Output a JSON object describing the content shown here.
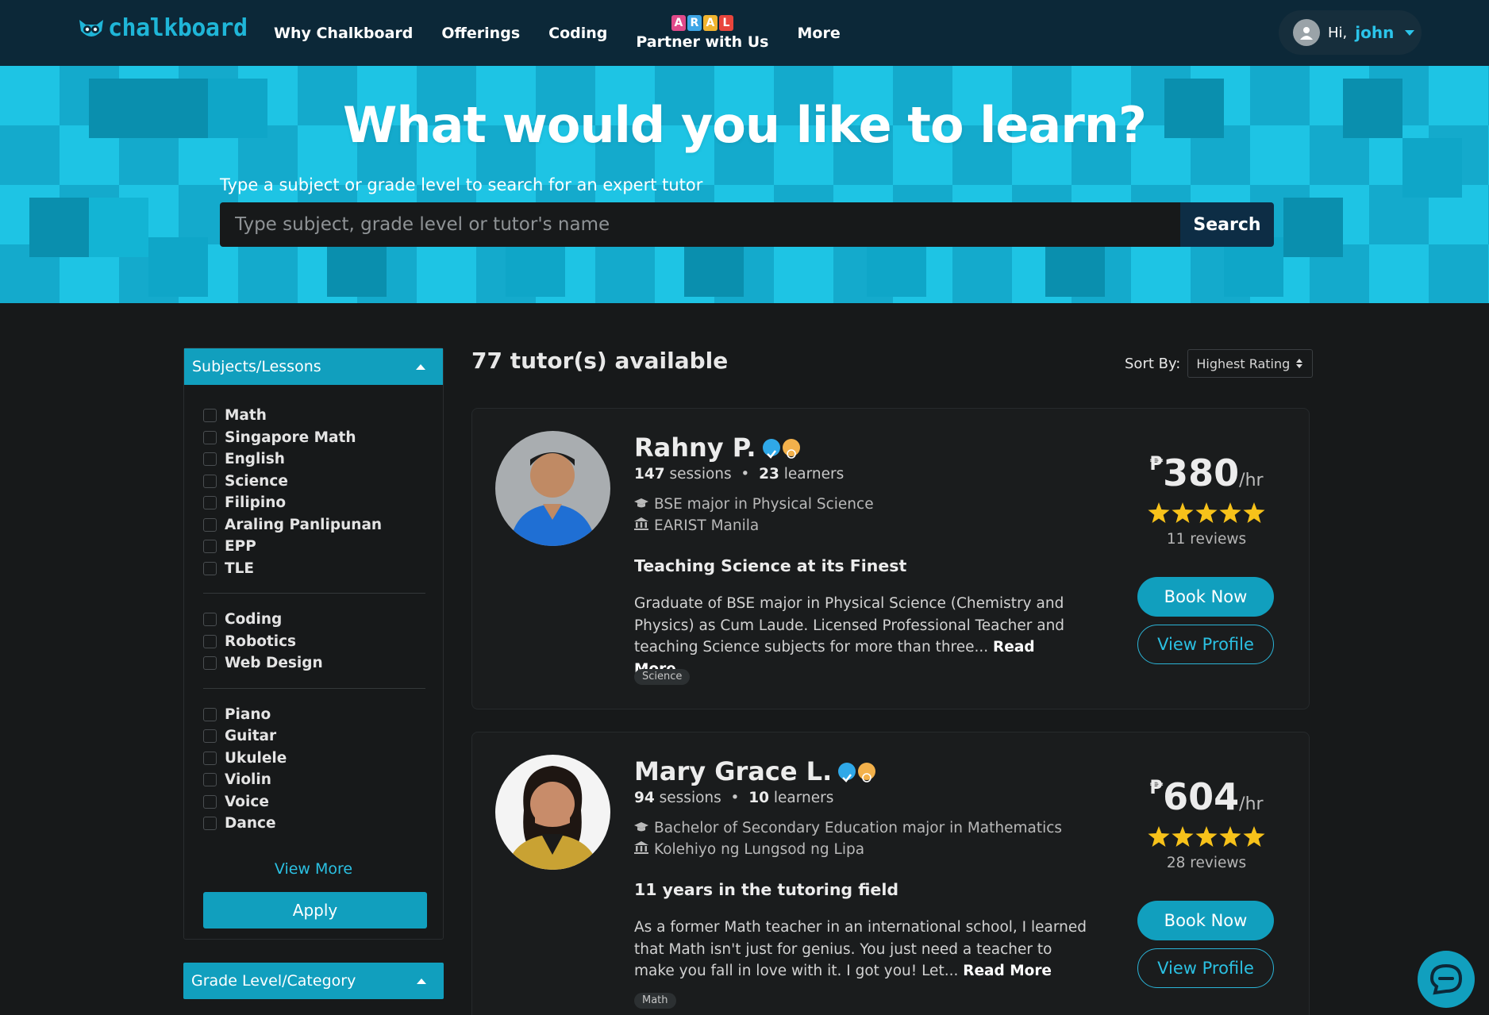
{
  "navbar": {
    "logo_text": "chalkboard",
    "links": [
      "Why Chalkboard",
      "Offerings",
      "Coding"
    ],
    "partner_badge_letters": [
      "A",
      "R",
      "A",
      "L"
    ],
    "partner_label": "Partner with Us",
    "more_label": "More",
    "user": {
      "greeting": "Hi,",
      "name": "john"
    }
  },
  "hero": {
    "title": "What would you like to learn?",
    "subtitle": "Type a subject or grade level to search for an expert tutor",
    "search_placeholder": "Type subject, grade level or tutor's name",
    "search_button": "Search"
  },
  "filters": {
    "subjects_header": "Subjects/Lessons",
    "groups": [
      [
        "Math",
        "Singapore Math",
        "English",
        "Science",
        "Filipino",
        "Araling Panlipunan",
        "EPP",
        "TLE"
      ],
      [
        "Coding",
        "Robotics",
        "Web Design"
      ],
      [
        "Piano",
        "Guitar",
        "Ukulele",
        "Violin",
        "Voice",
        "Dance"
      ]
    ],
    "view_more": "View More",
    "apply": "Apply",
    "grade_header": "Grade Level/Category"
  },
  "results": {
    "count_text": "77 tutor(s) available",
    "sort_label": "Sort By:",
    "sort_value": "Highest Rating"
  },
  "tutors": [
    {
      "name": "Rahny P.",
      "sessions": "147",
      "sessions_label": "sessions",
      "learners": "23",
      "learners_label": "learners",
      "degree": "BSE major in Physical Science",
      "school": "EARIST Manila",
      "headline": "Teaching Science at its Finest",
      "description": "Graduate of BSE major in Physical Science (Chemistry and Physics) as Cum Laude. Licensed Professional Teacher and teaching Science subjects for more than three...",
      "read_more": "Read More",
      "tag": "Science",
      "price_currency": "₱",
      "price": "380",
      "price_unit": "/hr",
      "rating": 5,
      "reviews": "11 reviews",
      "book_label": "Book Now",
      "profile_label": "View Profile"
    },
    {
      "name": "Mary Grace L.",
      "sessions": "94",
      "sessions_label": "sessions",
      "learners": "10",
      "learners_label": "learners",
      "degree": "Bachelor of Secondary Education major in Mathematics",
      "school": "Kolehiyo ng Lungsod ng Lipa",
      "headline": "11 years in the tutoring field",
      "description": "As a former Math teacher in an international school, I learned that Math isn't just for genius. You just need a teacher to make you fall in love with it. I got you! Let...",
      "read_more": "Read More",
      "tag": "Math",
      "price_currency": "₱",
      "price": "604",
      "price_unit": "/hr",
      "rating": 5,
      "reviews": "28 reviews",
      "book_label": "Book Now",
      "profile_label": "View Profile"
    }
  ],
  "colors": {
    "navbar_bg": "#0c2838",
    "accent": "#119fbe",
    "accent_light": "#2bc0e2",
    "hero_bg": "#1ec4e4",
    "page_bg": "#17191a",
    "star": "#f7c21a"
  },
  "icons": {
    "user": "user-avatar-icon",
    "chat": "chat-bubble-icon",
    "degree": "graduation-cap-icon",
    "school": "institution-icon",
    "verified": "verified-check-icon",
    "medal": "gold-medal-icon"
  }
}
